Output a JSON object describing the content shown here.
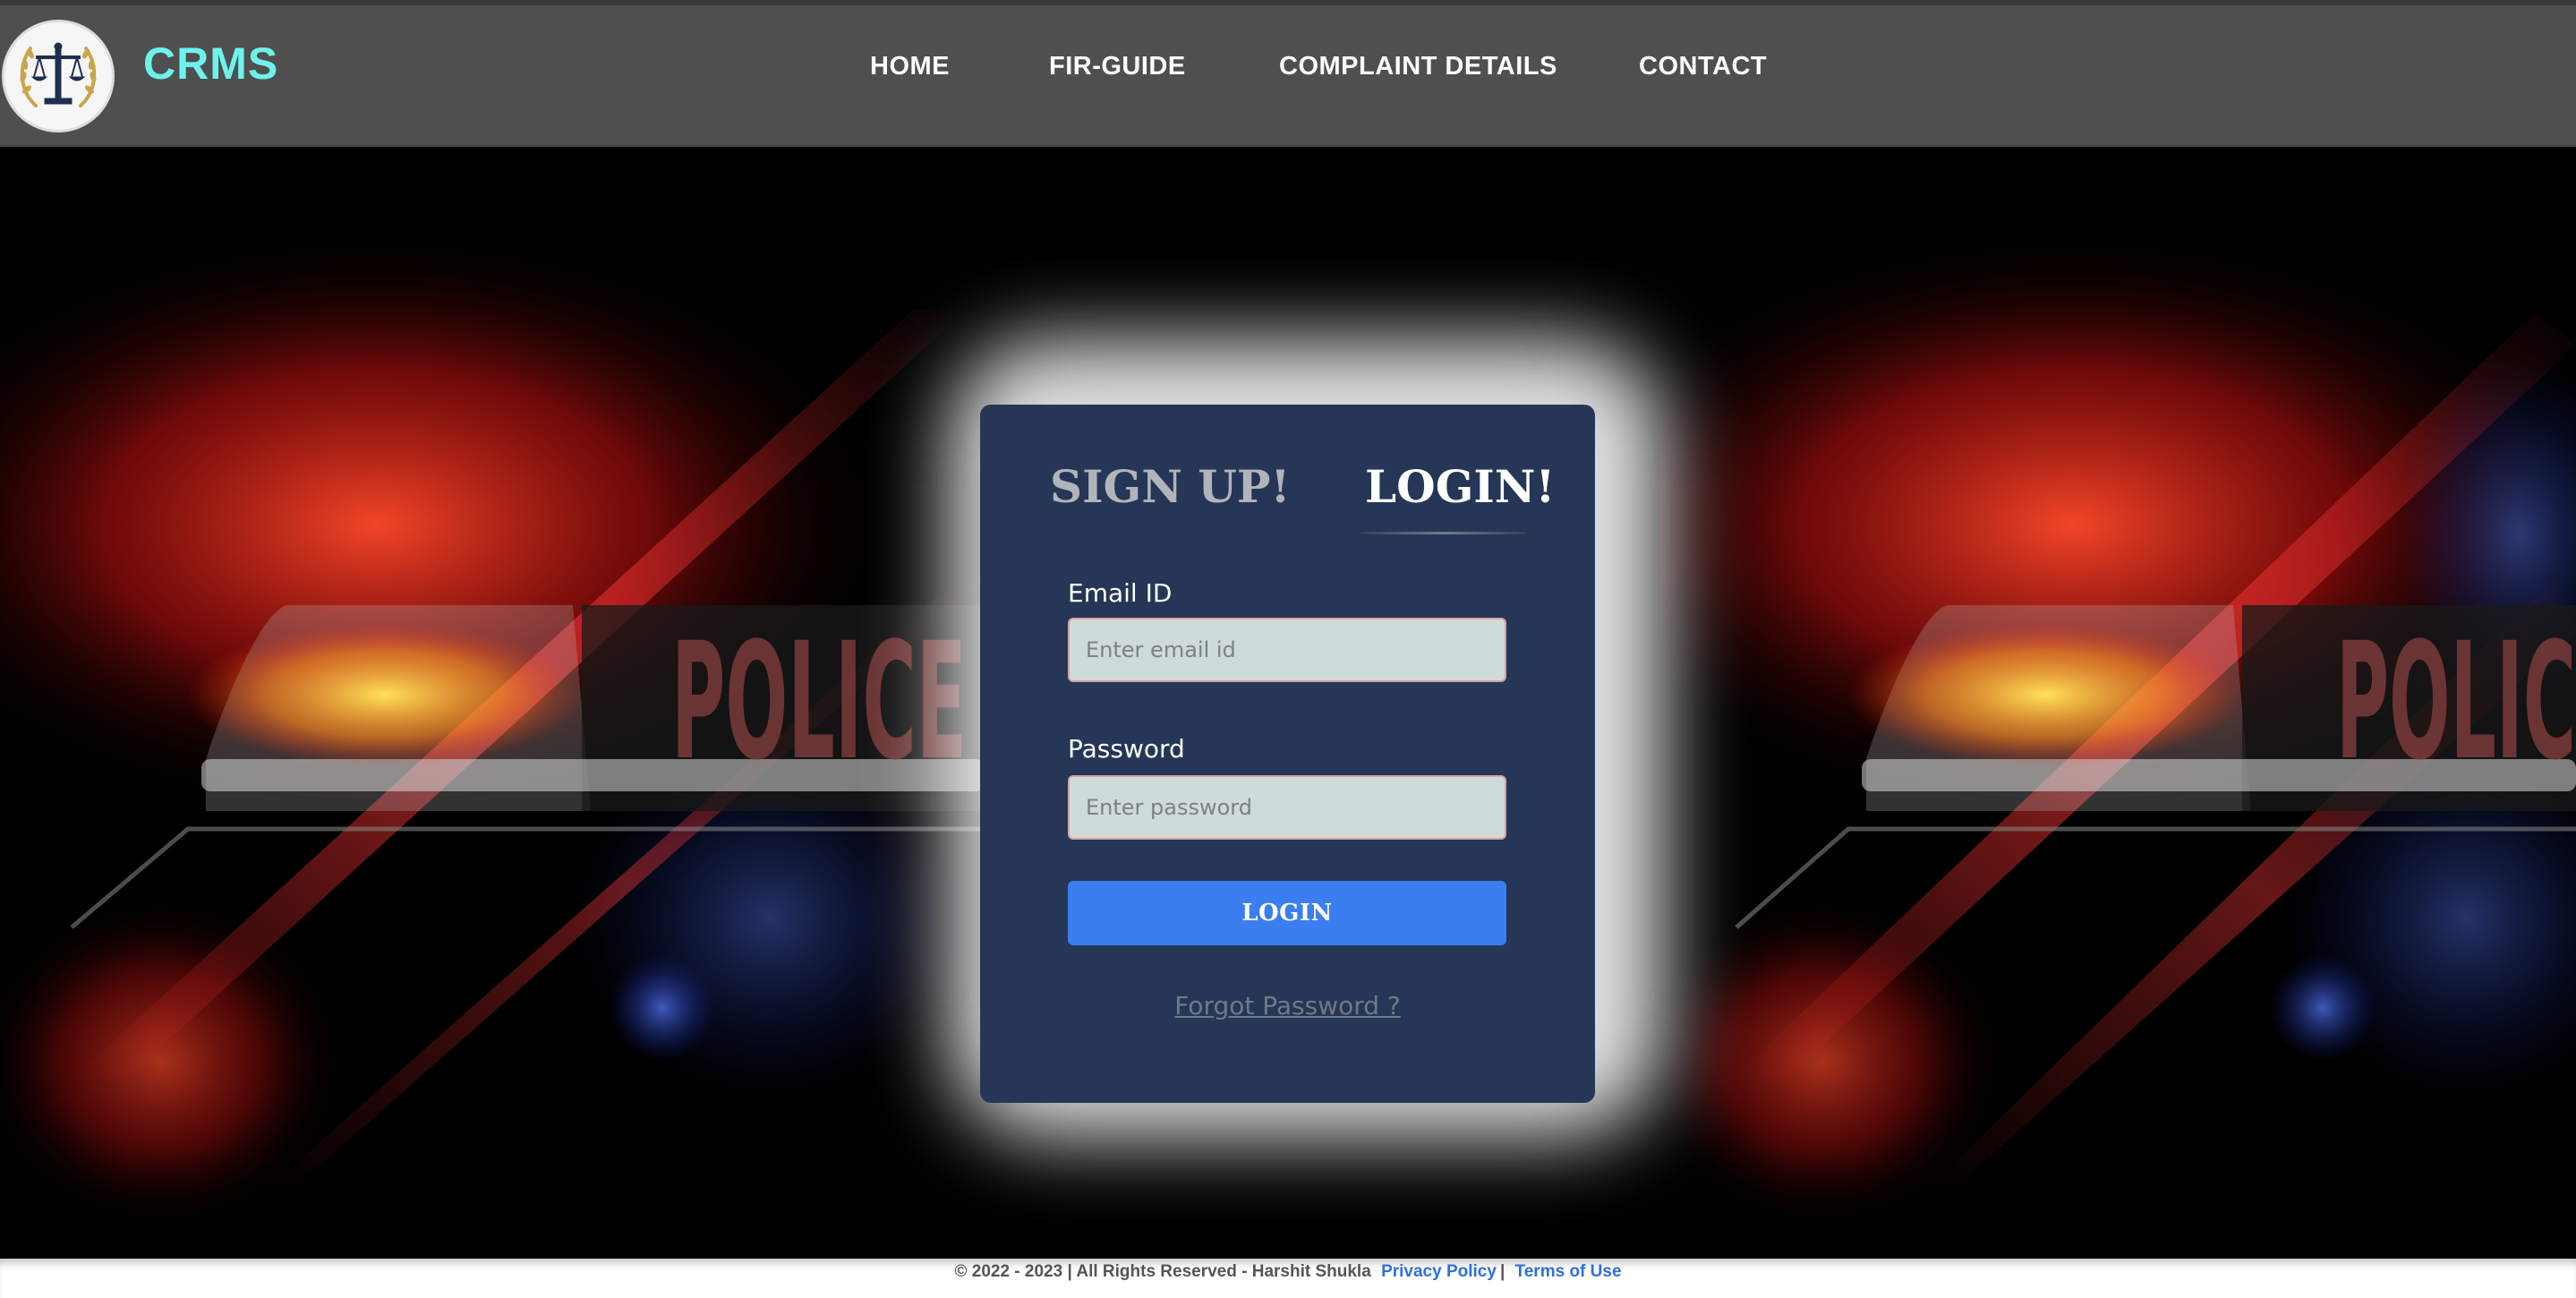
{
  "brand": {
    "title": "CRMS",
    "title_color": "#6ef3ec"
  },
  "nav": {
    "home": "HOME",
    "fir_guide": "FIR-GUIDE",
    "complaint_details": "COMPLAINT DETAILS",
    "contact": "CONTACT"
  },
  "hero": {
    "background_text": "POLICE",
    "background_text_right": "POLIC"
  },
  "form": {
    "tab_signup": "SIGN UP!",
    "tab_login": "LOGIN!",
    "email_label": "Email ID",
    "email_placeholder": "Enter email id",
    "email_value": "",
    "password_label": "Password",
    "password_placeholder": "Enter password",
    "password_value": "",
    "login_button": "LOGIN",
    "forgot_link": "Forgot Password ?",
    "card_color": "#253656",
    "button_color": "#3a7ef0"
  },
  "footer": {
    "copyright": "© 2022 - 2023 | All Rights Reserved - Harshit Shukla",
    "privacy": "Privacy Policy",
    "separator": "|",
    "terms": "Terms of Use",
    "link_color": "#2f6fe0"
  },
  "icons": {
    "logo": "scales-of-justice-laurel-emblem"
  }
}
